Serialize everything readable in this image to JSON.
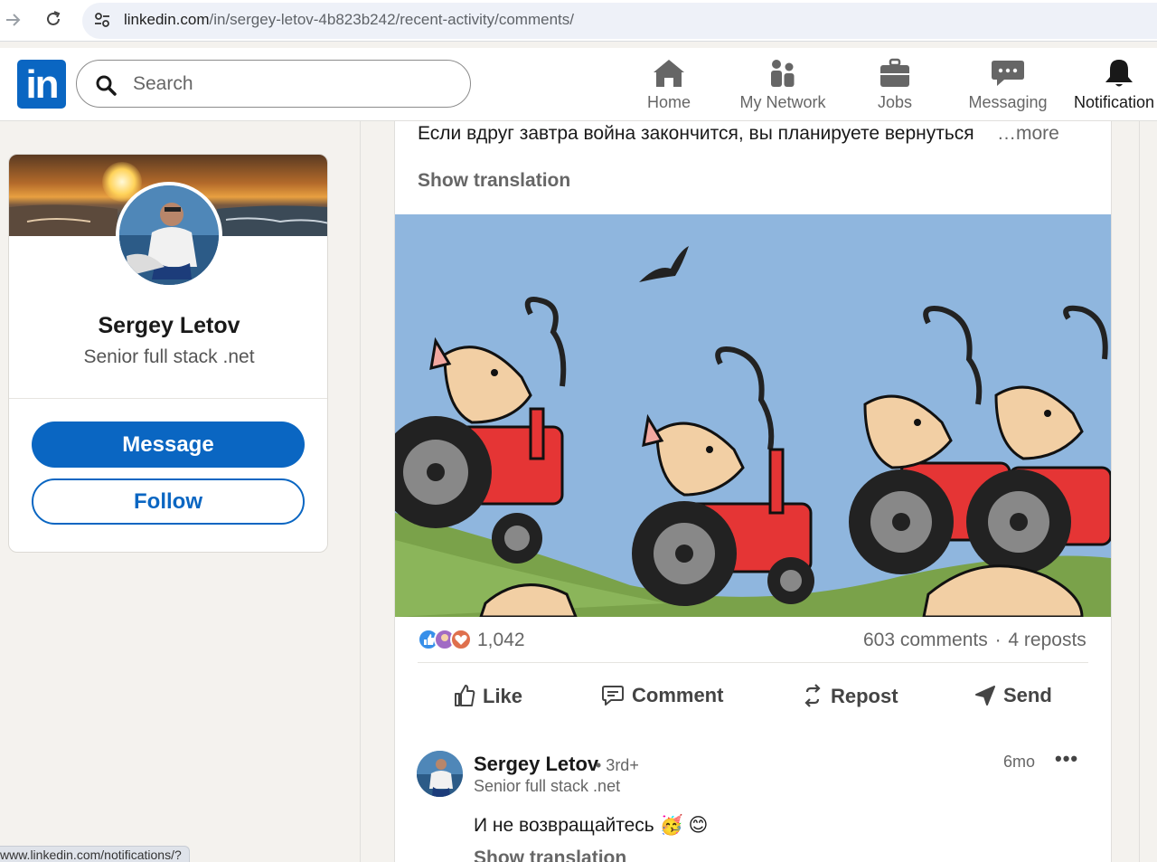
{
  "browser": {
    "url_host": "linkedin.com",
    "url_path": "/in/sergey-letov-4b823b242/recent-activity/comments/",
    "status_url": "www.linkedin.com/notifications/?"
  },
  "header": {
    "logo_text": "in",
    "search_placeholder": "Search",
    "nav": [
      {
        "label": "Home",
        "icon": "home-icon"
      },
      {
        "label": "My Network",
        "icon": "people-icon"
      },
      {
        "label": "Jobs",
        "icon": "briefcase-icon"
      },
      {
        "label": "Messaging",
        "icon": "chat-icon"
      },
      {
        "label": "Notification",
        "icon": "bell-icon"
      }
    ]
  },
  "profile": {
    "name": "Sergey Letov",
    "headline": "Senior full stack .net",
    "message_label": "Message",
    "follow_label": "Follow"
  },
  "post": {
    "text": "Если вдруг завтра война закончится, вы планируете вернуться",
    "more_label": "…more",
    "translation_label": "Show translation",
    "reaction_count": "1,042",
    "comments_count": "603 comments",
    "separator": "·",
    "reposts_count": "4 reposts",
    "actions": [
      {
        "label": "Like",
        "icon": "thumb-up-icon"
      },
      {
        "label": "Comment",
        "icon": "comment-icon"
      },
      {
        "label": "Repost",
        "icon": "repost-icon"
      },
      {
        "label": "Send",
        "icon": "send-icon"
      }
    ]
  },
  "comment": {
    "author": "Sergey Letov",
    "degree": "• 3rd+",
    "headline": "Senior full stack .net",
    "time": "6mo",
    "menu": "•••",
    "text": "И не возвращайтесь 🥳 😊",
    "translation_label": "Show translation"
  },
  "colors": {
    "brand": "#0a66c2",
    "background": "#f4f2ee"
  }
}
